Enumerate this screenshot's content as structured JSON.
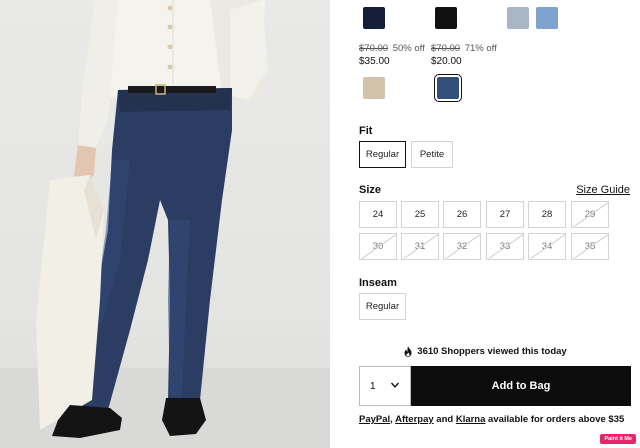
{
  "colors": {
    "swatches_row1": [
      "#152038",
      "#111111",
      "#a9b6c6",
      "#7fa3cf"
    ],
    "swatches_row2": [
      "#d2c3ad",
      "#34507a"
    ],
    "cta_bg": "#0c0c0c",
    "badge_bg": "#e8246b"
  },
  "prices": [
    {
      "was": "$70.00",
      "off": "50% off",
      "now": "$35.00"
    },
    {
      "was": "$70.00",
      "off": "71% off",
      "now": "$20.00"
    }
  ],
  "fit": {
    "label": "Fit",
    "options": [
      "Regular",
      "Petite"
    ],
    "selected": "Regular"
  },
  "size": {
    "label": "Size",
    "guide_link": "Size Guide",
    "options": [
      "24",
      "25",
      "26",
      "27",
      "28",
      "29",
      "30",
      "31",
      "32",
      "33",
      "34",
      "35"
    ],
    "unavailable": [
      "29",
      "30",
      "31",
      "32",
      "33",
      "34",
      "35"
    ]
  },
  "inseam": {
    "label": "Inseam",
    "options": [
      "Regular"
    ]
  },
  "viewers_text": "3610 Shoppers viewed this today",
  "quantity": "1",
  "add_to_bag": "Add to Bag",
  "payment": {
    "paypal": "PayPal",
    "sep": ",",
    "afterpay": "Afterpay",
    "and": "and",
    "klarna": "Klarna",
    "suffix": "available for orders above $35"
  },
  "badge": "Paint it Me"
}
